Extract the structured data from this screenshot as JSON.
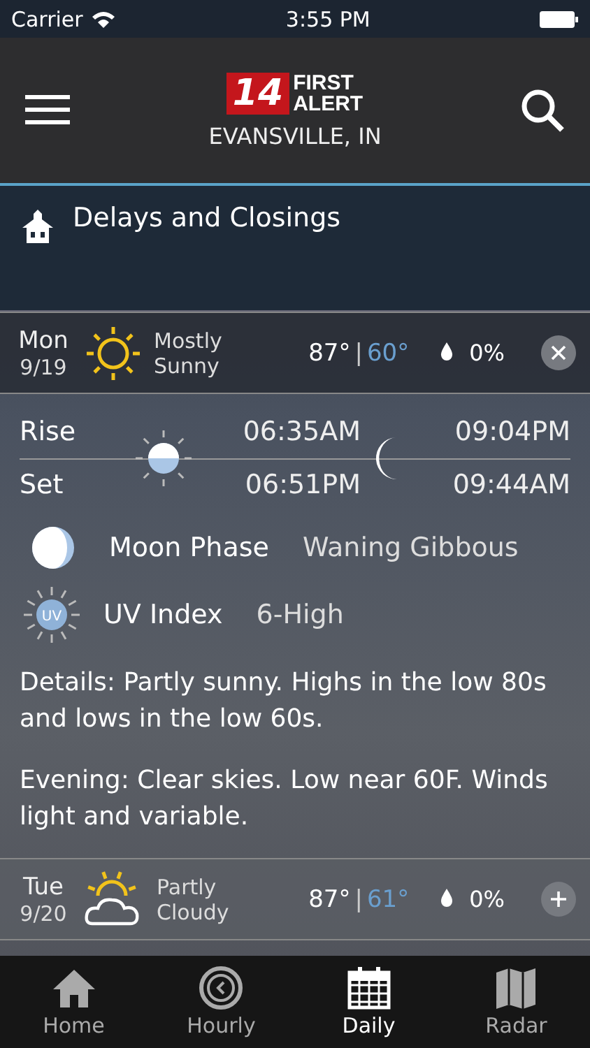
{
  "status_bar": {
    "carrier": "Carrier",
    "time": "3:55 PM"
  },
  "header": {
    "logo_number": "14",
    "logo_line_1": "FIRST",
    "logo_line_2": "ALERT",
    "location": "EVANSVILLE, IN"
  },
  "alert_banner": {
    "label": "Delays and Closings"
  },
  "days": [
    {
      "day": "Mon",
      "date": "9/19",
      "kind": "sunny",
      "summary_1": "Mostly",
      "summary_2": "Sunny",
      "high": "87°",
      "separator": "|",
      "low": "60°",
      "precip": "0%",
      "expanded": true,
      "detail": {
        "rise_label": "Rise",
        "set_label": "Set",
        "sunrise": "06:35AM",
        "sunset": "06:51PM",
        "moonrise": "09:04PM",
        "moonset": "09:44AM",
        "moon_phase_label": "Moon Phase",
        "moon_phase": "Waning Gibbous",
        "uv_badge": "UV",
        "uv_label": "UV Index",
        "uv_value": "6-High",
        "paragraphs": [
          "Details: Partly sunny. Highs in the low 80s and lows in the low 60s.",
          "Evening: Clear skies. Low near 60F. Winds light and variable."
        ]
      }
    },
    {
      "day": "Tue",
      "date": "9/20",
      "kind": "partly-cloudy",
      "summary_1": "Partly",
      "summary_2": "Cloudy",
      "high": "87°",
      "separator": "|",
      "low": "61°",
      "precip": "0%",
      "expanded": false
    }
  ],
  "tabs": [
    {
      "label": "Home",
      "kind": "home",
      "selected": false
    },
    {
      "label": "Hourly",
      "kind": "hourly",
      "selected": false
    },
    {
      "label": "Daily",
      "kind": "daily",
      "selected": true
    },
    {
      "label": "Radar",
      "kind": "radar",
      "selected": false
    }
  ]
}
